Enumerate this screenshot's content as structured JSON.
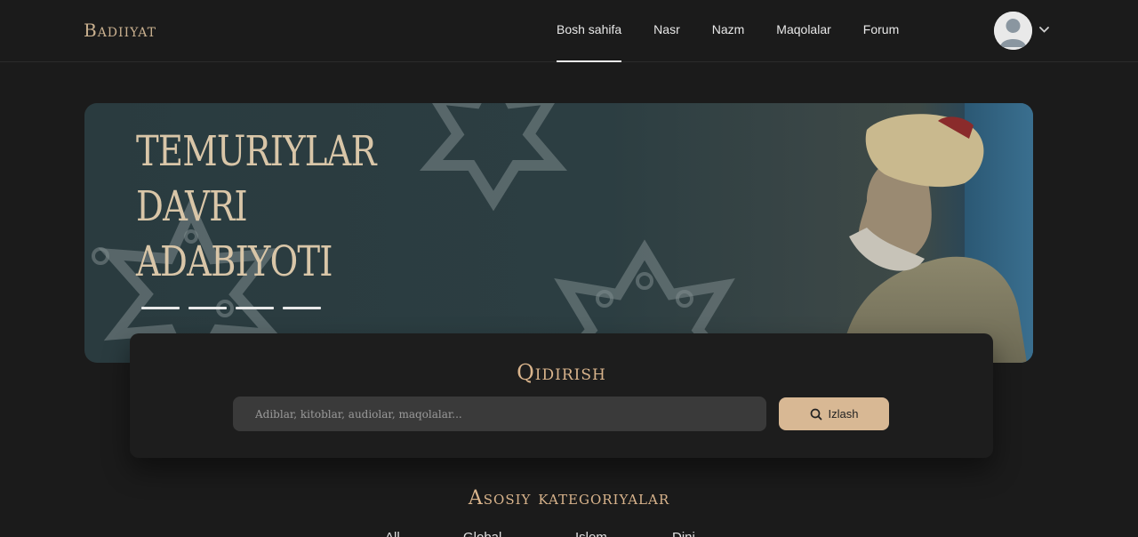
{
  "header": {
    "logo": "Badiiyat",
    "nav": [
      {
        "label": "Bosh sahifa",
        "active": true
      },
      {
        "label": "Nasr",
        "active": false
      },
      {
        "label": "Nazm",
        "active": false
      },
      {
        "label": "Maqolalar",
        "active": false
      },
      {
        "label": "Forum",
        "active": false
      }
    ],
    "avatar_icon": "user-avatar-icon",
    "menu_icon": "chevron-down-icon"
  },
  "hero": {
    "title_lines": [
      "Temuriylar",
      "davri",
      "adabiyoti"
    ],
    "slides": 4,
    "active_slide": 1
  },
  "search": {
    "title": "Qidirish",
    "placeholder": "Adiblar, kitoblar, audiolar, maqolalar...",
    "button_label": "Izlash",
    "button_icon": "search-icon"
  },
  "categories": {
    "title": "Asosiy kategoriyalar",
    "tabs": [
      "All",
      "Global",
      "Islom",
      "Dini"
    ]
  },
  "colors": {
    "accent": "#d8b894",
    "gold_text": "#d9b48c",
    "background": "#1b1b1b",
    "hero_teal": "#2c3e42"
  }
}
